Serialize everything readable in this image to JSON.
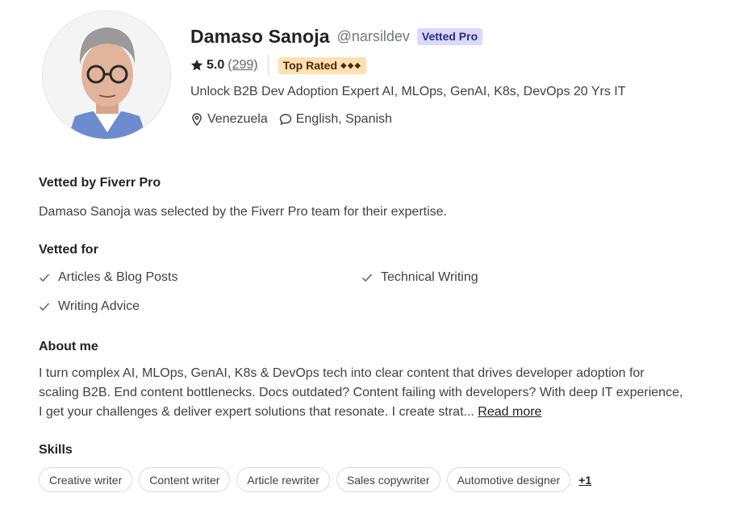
{
  "profile": {
    "name": "Damaso Sanoja",
    "handle": "@narsildev",
    "badge": "Vetted Pro",
    "rating": "5.0",
    "review_count": "(299)",
    "top_rated_label": "Top Rated",
    "top_rated_diamonds": "◆◆◆",
    "tagline": "Unlock B2B Dev Adoption Expert AI, MLOps, GenAI, K8s, DevOps 20 Yrs IT",
    "location": "Venezuela",
    "languages": "English, Spanish"
  },
  "vetted_by": {
    "title": "Vetted by Fiverr Pro",
    "text": "Damaso Sanoja was selected by the Fiverr Pro team for their expertise."
  },
  "vetted_for": {
    "title": "Vetted for",
    "items": [
      "Articles & Blog Posts",
      "Technical Writing",
      "Writing Advice"
    ]
  },
  "about": {
    "title": "About me",
    "text": "I turn complex AI, MLOps, GenAI, K8s & DevOps tech into clear content that drives developer adoption for scaling B2B. End content bottlenecks. Docs outdated? Content failing with developers? With deep IT experience, I get your challenges & deliver expert solutions that resonate. I create strat... ",
    "read_more": "Read more"
  },
  "skills": {
    "title": "Skills",
    "items": [
      "Creative writer",
      "Content writer",
      "Article rewriter",
      "Sales copywriter",
      "Automotive designer"
    ],
    "more": "+1"
  },
  "icons": {
    "star": "star-icon",
    "location": "location-pin-icon",
    "language": "speech-bubble-icon",
    "check": "checkmark-icon"
  },
  "colors": {
    "vetted_badge_bg": "#d9d8ff",
    "top_rated_bg": "#ffe0b3"
  }
}
